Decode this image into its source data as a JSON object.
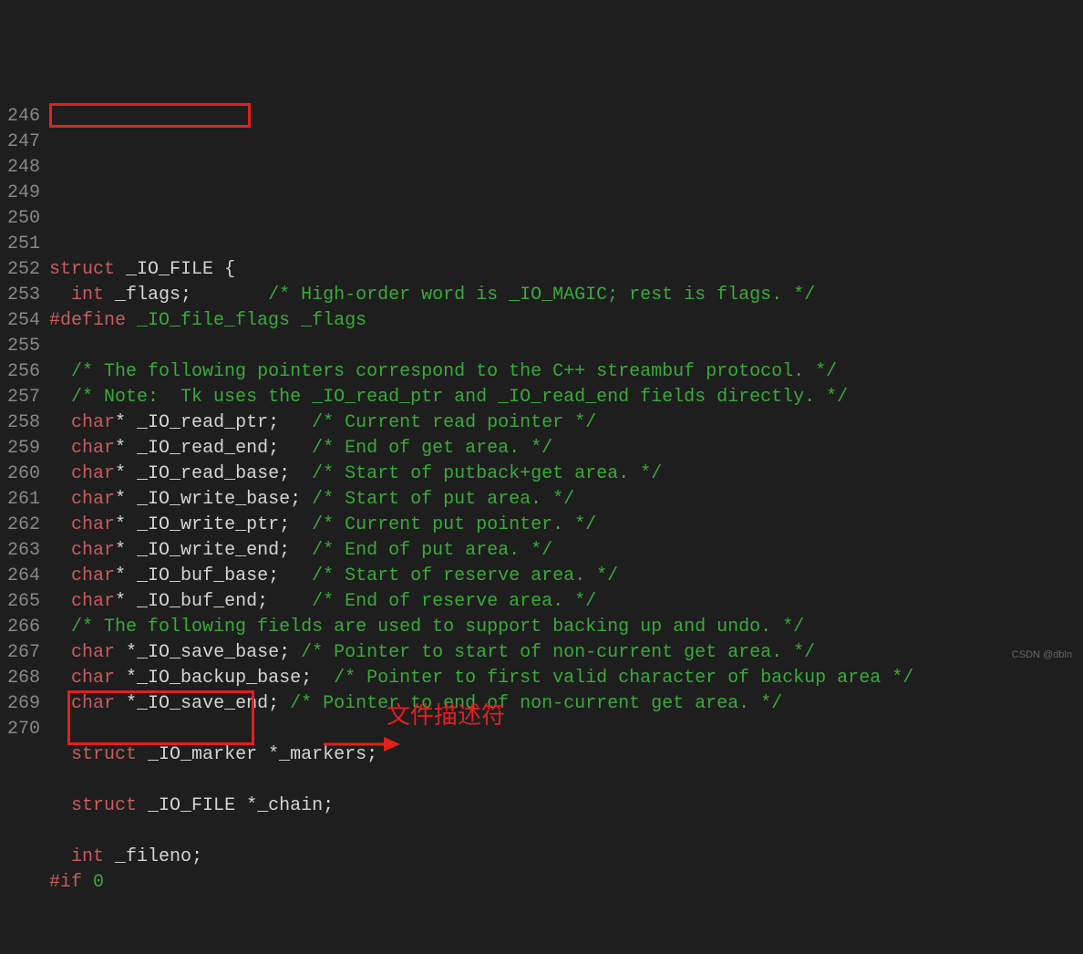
{
  "watermark": "CSDN @dbln",
  "annotation_text": "文件描述符",
  "line_numbers": [
    "246",
    "247",
    "248",
    "249",
    "250",
    "251",
    "252",
    "253",
    "254",
    "255",
    "256",
    "257",
    "258",
    "259",
    "260",
    "261",
    "262",
    "263",
    "264",
    "265",
    "266",
    "267",
    "268",
    "269",
    "270"
  ],
  "code_lines": [
    {
      "segments": [
        {
          "t": "struct",
          "c": "kw"
        },
        {
          "t": " _IO_FILE ",
          "c": "ident"
        },
        {
          "t": "{",
          "c": "punct"
        }
      ]
    },
    {
      "segments": [
        {
          "t": "  ",
          "c": "ident"
        },
        {
          "t": "int",
          "c": "kw"
        },
        {
          "t": " _flags;       ",
          "c": "ident"
        },
        {
          "t": "/* High-order word is _IO_MAGIC; rest is flags. */",
          "c": "cm"
        }
      ]
    },
    {
      "segments": [
        {
          "t": "#define",
          "c": "kw"
        },
        {
          "t": " _IO_file_flags _flags",
          "c": "cm"
        }
      ]
    },
    {
      "segments": [
        {
          "t": "",
          "c": "ident"
        }
      ]
    },
    {
      "segments": [
        {
          "t": "  ",
          "c": "ident"
        },
        {
          "t": "/* The following pointers correspond to the C++ streambuf protocol. */",
          "c": "cm"
        }
      ]
    },
    {
      "segments": [
        {
          "t": "  ",
          "c": "ident"
        },
        {
          "t": "/* Note:  Tk uses the _IO_read_ptr and _IO_read_end fields directly. */",
          "c": "cm"
        }
      ]
    },
    {
      "segments": [
        {
          "t": "  ",
          "c": "ident"
        },
        {
          "t": "char",
          "c": "kw"
        },
        {
          "t": "* _IO_read_ptr;   ",
          "c": "ident"
        },
        {
          "t": "/* Current read pointer */",
          "c": "cm"
        }
      ]
    },
    {
      "segments": [
        {
          "t": "  ",
          "c": "ident"
        },
        {
          "t": "char",
          "c": "kw"
        },
        {
          "t": "* _IO_read_end;   ",
          "c": "ident"
        },
        {
          "t": "/* End of get area. */",
          "c": "cm"
        }
      ]
    },
    {
      "segments": [
        {
          "t": "  ",
          "c": "ident"
        },
        {
          "t": "char",
          "c": "kw"
        },
        {
          "t": "* _IO_read_base;  ",
          "c": "ident"
        },
        {
          "t": "/* Start of putback+get area. */",
          "c": "cm"
        }
      ]
    },
    {
      "segments": [
        {
          "t": "  ",
          "c": "ident"
        },
        {
          "t": "char",
          "c": "kw"
        },
        {
          "t": "* _IO_write_base; ",
          "c": "ident"
        },
        {
          "t": "/* Start of put area. */",
          "c": "cm"
        }
      ]
    },
    {
      "segments": [
        {
          "t": "  ",
          "c": "ident"
        },
        {
          "t": "char",
          "c": "kw"
        },
        {
          "t": "* _IO_write_ptr;  ",
          "c": "ident"
        },
        {
          "t": "/* Current put pointer. */",
          "c": "cm"
        }
      ]
    },
    {
      "segments": [
        {
          "t": "  ",
          "c": "ident"
        },
        {
          "t": "char",
          "c": "kw"
        },
        {
          "t": "* _IO_write_end;  ",
          "c": "ident"
        },
        {
          "t": "/* End of put area. */",
          "c": "cm"
        }
      ]
    },
    {
      "segments": [
        {
          "t": "  ",
          "c": "ident"
        },
        {
          "t": "char",
          "c": "kw"
        },
        {
          "t": "* _IO_buf_base;   ",
          "c": "ident"
        },
        {
          "t": "/* Start of reserve area. */",
          "c": "cm"
        }
      ]
    },
    {
      "segments": [
        {
          "t": "  ",
          "c": "ident"
        },
        {
          "t": "char",
          "c": "kw"
        },
        {
          "t": "* _IO_buf_end;    ",
          "c": "ident"
        },
        {
          "t": "/* End of reserve area. */",
          "c": "cm"
        }
      ]
    },
    {
      "segments": [
        {
          "t": "  ",
          "c": "ident"
        },
        {
          "t": "/* The following fields are used to support backing up and undo. */",
          "c": "cm"
        }
      ]
    },
    {
      "segments": [
        {
          "t": "  ",
          "c": "ident"
        },
        {
          "t": "char",
          "c": "kw"
        },
        {
          "t": " *_IO_save_base; ",
          "c": "ident"
        },
        {
          "t": "/* Pointer to start of non-current get area. */",
          "c": "cm"
        }
      ]
    },
    {
      "segments": [
        {
          "t": "  ",
          "c": "ident"
        },
        {
          "t": "char",
          "c": "kw"
        },
        {
          "t": " *_IO_backup_base;  ",
          "c": "ident"
        },
        {
          "t": "/* Pointer to first valid character of backup area */",
          "c": "cm"
        }
      ]
    },
    {
      "segments": [
        {
          "t": "  ",
          "c": "ident"
        },
        {
          "t": "char",
          "c": "kw"
        },
        {
          "t": " *_IO_save_end; ",
          "c": "ident"
        },
        {
          "t": "/* Pointer to end of non-current get area. */",
          "c": "cm"
        }
      ]
    },
    {
      "segments": [
        {
          "t": "",
          "c": "ident"
        }
      ]
    },
    {
      "segments": [
        {
          "t": "  ",
          "c": "ident"
        },
        {
          "t": "struct",
          "c": "kw"
        },
        {
          "t": " _IO_marker *_markers;",
          "c": "ident"
        }
      ]
    },
    {
      "segments": [
        {
          "t": "",
          "c": "ident"
        }
      ]
    },
    {
      "segments": [
        {
          "t": "  ",
          "c": "ident"
        },
        {
          "t": "struct",
          "c": "kw"
        },
        {
          "t": " _IO_FILE *_chain;",
          "c": "ident"
        }
      ]
    },
    {
      "segments": [
        {
          "t": "",
          "c": "ident"
        }
      ]
    },
    {
      "segments": [
        {
          "t": "  ",
          "c": "ident"
        },
        {
          "t": "int",
          "c": "kw"
        },
        {
          "t": " _fileno;",
          "c": "ident"
        }
      ]
    },
    {
      "segments": [
        {
          "t": "#if",
          "c": "kw"
        },
        {
          "t": " ",
          "c": "ident"
        },
        {
          "t": "0",
          "c": "cm"
        }
      ]
    }
  ]
}
